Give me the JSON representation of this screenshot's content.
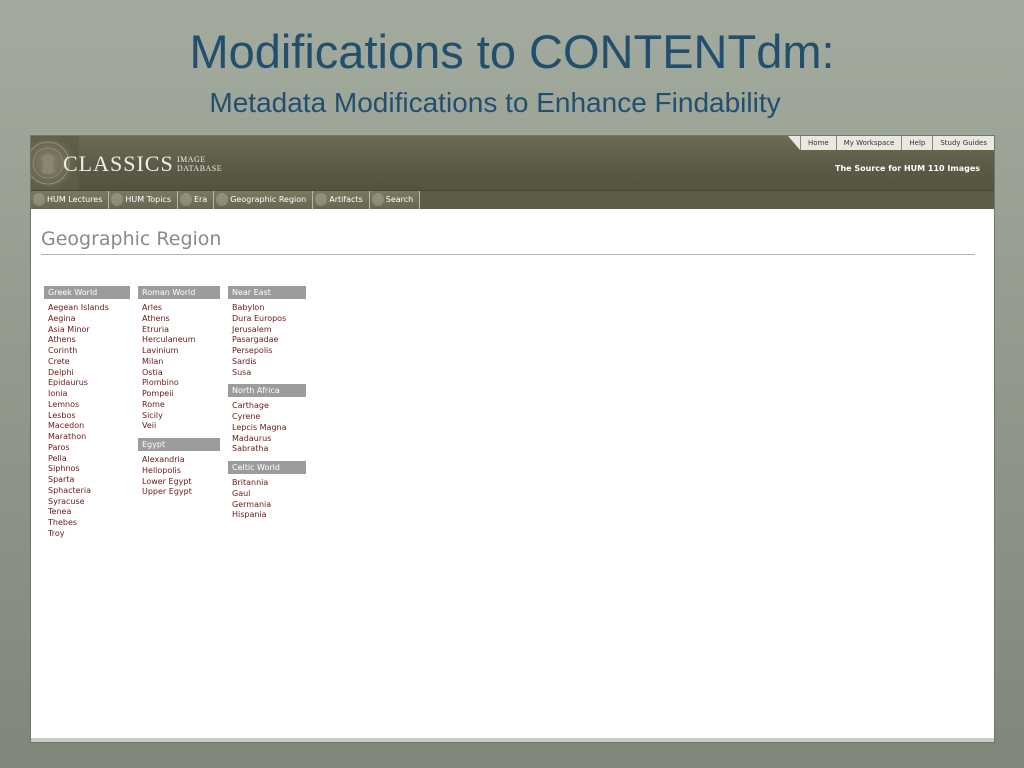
{
  "slide": {
    "title": "Modifications to CONTENTdm:",
    "subtitle": "Metadata Modifications to Enhance Findability"
  },
  "site": {
    "logo_main": "CLASSICS",
    "logo_sub_1": "IMAGE",
    "logo_sub_2": "DATABASE",
    "tagline": "The Source for HUM 110 Images",
    "toplinks": [
      "Home",
      "My Workspace",
      "Help",
      "Study Guides"
    ],
    "nav": [
      "HUM Lectures",
      "HUM Topics",
      "Era",
      "Geographic Region",
      "Artifacts",
      "Search"
    ]
  },
  "page": {
    "heading": "Geographic Region"
  },
  "columns": [
    {
      "boxes": [
        {
          "title": "Greek World",
          "items": [
            "Aegean Islands",
            "Aegina",
            "Asia Minor",
            "Athens",
            "Corinth",
            "Crete",
            "Delphi",
            "Epidaurus",
            "Ionia",
            "Lemnos",
            "Lesbos",
            "Macedon",
            "Marathon",
            "Paros",
            "Pella",
            "Siphnos",
            "Sparta",
            "Sphacteria",
            "Syracuse",
            "Tenea",
            "Thebes",
            "Troy"
          ]
        }
      ]
    },
    {
      "boxes": [
        {
          "title": "Roman World",
          "items": [
            "Arles",
            "Athens",
            "Etruria",
            "Herculaneum",
            "Lavinium",
            "Milan",
            "Ostia",
            "Piombino",
            "Pompeii",
            "Rome",
            "Sicily",
            "Veii"
          ]
        },
        {
          "title": "Egypt",
          "items": [
            "Alexandria",
            "Heliopolis",
            "Lower Egypt",
            "Upper Egypt"
          ]
        }
      ]
    },
    {
      "boxes": [
        {
          "title": "Near East",
          "items": [
            "Babylon",
            "Dura Europos",
            "Jerusalem",
            "Pasargadae",
            "Persepolis",
            "Sardis",
            "Susa"
          ]
        },
        {
          "title": "North Africa",
          "items": [
            "Carthage",
            "Cyrene",
            "Lepcis Magna",
            "Madaurus",
            "Sabratha"
          ]
        },
        {
          "title": "Celtic World",
          "items": [
            "Britannia",
            "Gaul",
            "Germania",
            "Hispania"
          ]
        }
      ]
    }
  ]
}
